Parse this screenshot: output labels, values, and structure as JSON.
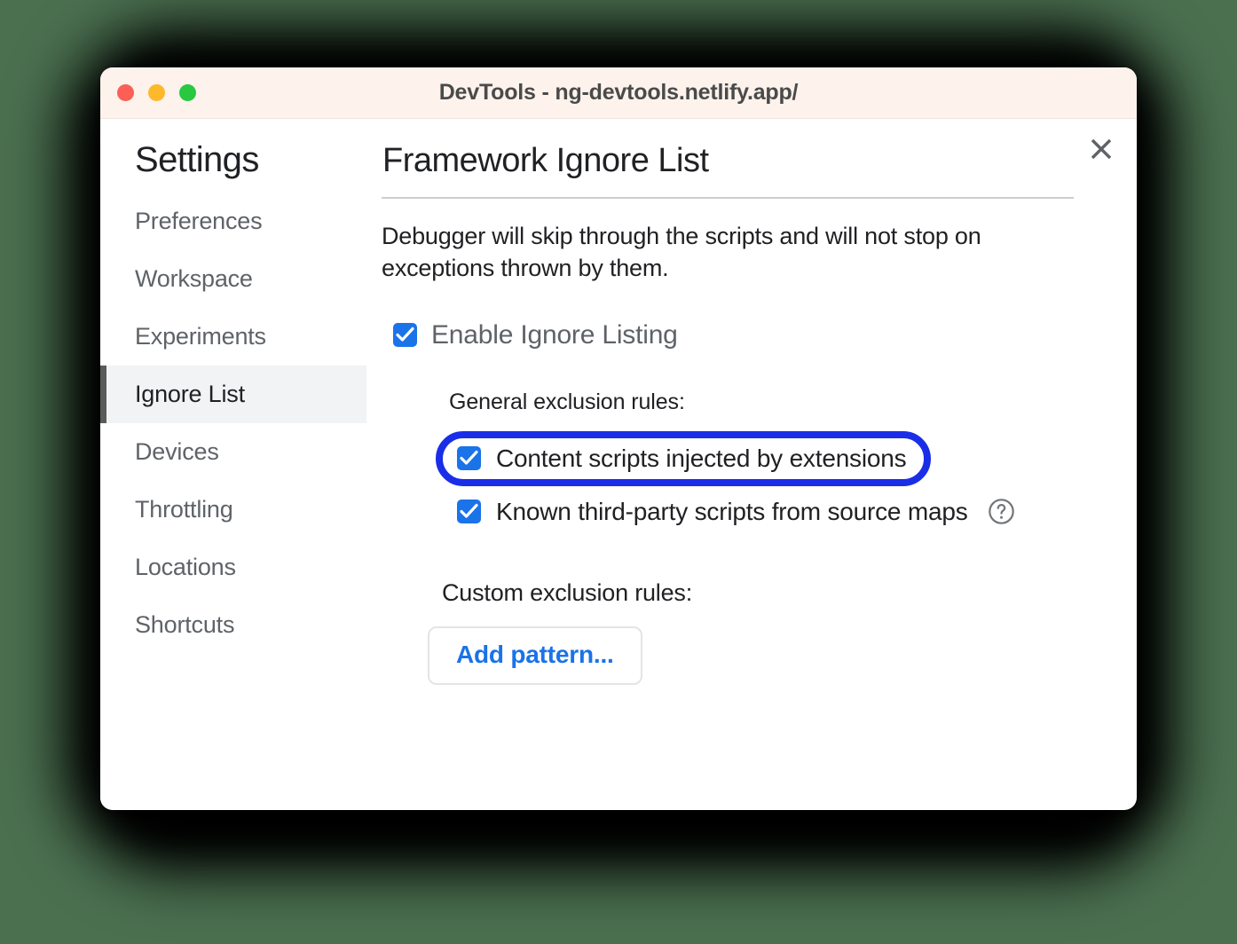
{
  "window": {
    "title": "DevTools - ng-devtools.netlify.app/",
    "traffic_lights": [
      {
        "name": "close",
        "color": "#fc5f55"
      },
      {
        "name": "minimize",
        "color": "#fcb92b"
      },
      {
        "name": "maximize",
        "color": "#28c840"
      }
    ],
    "titlebar_bg": "#fdf2ec"
  },
  "sidebar": {
    "heading": "Settings",
    "items": [
      {
        "label": "Preferences",
        "selected": false
      },
      {
        "label": "Workspace",
        "selected": false
      },
      {
        "label": "Experiments",
        "selected": false
      },
      {
        "label": "Ignore List",
        "selected": true
      },
      {
        "label": "Devices",
        "selected": false
      },
      {
        "label": "Throttling",
        "selected": false
      },
      {
        "label": "Locations",
        "selected": false
      },
      {
        "label": "Shortcuts",
        "selected": false
      }
    ],
    "selected_item": "Ignore List",
    "selected_bg": "#f1f3f4",
    "selected_indicator_color": "#5a5a5a"
  },
  "main": {
    "title": "Framework Ignore List",
    "description": "Debugger will skip through the scripts and will not stop on exceptions thrown by them.",
    "close_icon": "close-icon",
    "enable_toggle": {
      "label": "Enable Ignore Listing",
      "checked": true
    },
    "general_rules": {
      "label": "General exclusion rules:",
      "items": [
        {
          "label": "Content scripts injected by extensions",
          "checked": true,
          "annotated": true,
          "help_icon": false
        },
        {
          "label": "Known third-party scripts from source maps",
          "checked": true,
          "annotated": false,
          "help_icon": true
        }
      ]
    },
    "custom_rules": {
      "label": "Custom exclusion rules:",
      "add_button_label": "Add pattern..."
    }
  },
  "colors": {
    "page_background": "#4b7050",
    "checkbox_accent": "#1a73e8",
    "link_accent": "#1a73e8",
    "annotation_highlight": "#1a2ee8",
    "divider": "#cdcdcd"
  }
}
